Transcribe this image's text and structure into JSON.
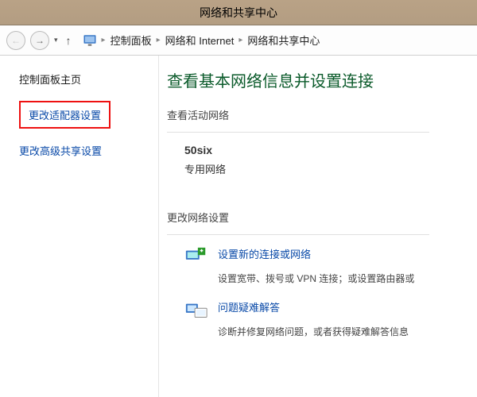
{
  "window": {
    "title": "网络和共享中心"
  },
  "breadcrumb": {
    "root": "控制面板",
    "mid": "网络和 Internet",
    "leaf": "网络和共享中心"
  },
  "sidebar": {
    "home": "控制面板主页",
    "adapter": "更改适配器设置",
    "advanced": "更改高级共享设置"
  },
  "main": {
    "heading": "查看基本网络信息并设置连接",
    "active_networks_label": "查看活动网络",
    "network": {
      "name": "50six",
      "type": "专用网络"
    },
    "change_settings_label": "更改网络设置",
    "action1": {
      "link": "设置新的连接或网络",
      "desc": "设置宽带、拨号或 VPN 连接；或设置路由器或"
    },
    "action2": {
      "link": "问题疑难解答",
      "desc": "诊断并修复网络问题，或者获得疑难解答信息"
    }
  }
}
